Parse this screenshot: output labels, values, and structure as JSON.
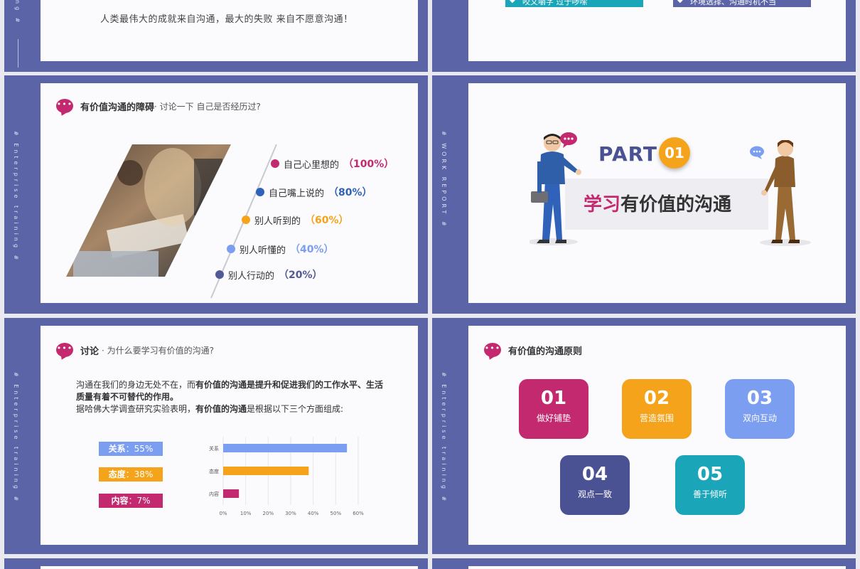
{
  "colors": {
    "frame": "#5a64a6",
    "magenta": "#c3296f",
    "blue": "#2f62b8",
    "orange": "#f5a31a",
    "light_blue": "#7c9ef0",
    "navy": "#525a96",
    "teal": "#1aa5b8",
    "indigo": "#4b5294"
  },
  "slide_top_left": {
    "quote": "人类最伟大的成就来自沟通，最大的失败  来自不愿意沟通！",
    "side_text": "ng #"
  },
  "slide_top_right": {
    "tags": [
      "咬文嚼字  过于啰嗦",
      "环境选择、沟通时机不当"
    ]
  },
  "slide_obstacles": {
    "side_text": "# Enterprise training #",
    "title_bold": "有价值沟通的障碍",
    "title_rest": "· 讨论一下 自己是否经历过?",
    "levels": [
      {
        "label": "自己心里想的",
        "pct": "（100%）",
        "color": "#c3296f"
      },
      {
        "label": "自己嘴上说的",
        "pct": "（80%）",
        "color": "#2f62b8"
      },
      {
        "label": "别人听到的",
        "pct": "（60%）",
        "color": "#f5a31a"
      },
      {
        "label": "别人听懂的",
        "pct": "（40%）",
        "color": "#7c9ef0"
      },
      {
        "label": "别人行动的",
        "pct": "（20%）",
        "color": "#525a96"
      }
    ]
  },
  "slide_part": {
    "side_text": "# WORK  REPORT #",
    "part_label": "PART",
    "part_num": "01",
    "heading_accent": "学习",
    "heading_rest": "有价值的沟通"
  },
  "slide_discuss": {
    "side_text": "# Enterprise training #",
    "title_bold": "讨论",
    "title_rest": "· 为什么要学习有价值的沟通?",
    "para1_a": "沟通在我们的身边无处不在，而",
    "para1_b": "有价值的沟通是提升和促进我们的工作水平、生活质量有着不可替代的作用。",
    "para2_a": "据哈佛大学调查研究实验表明，",
    "para2_b": "有价值的沟通",
    "para2_c": "是根据以下三个方面组成:",
    "stats": [
      {
        "name": "关系",
        "value": "55%",
        "color": "#7c9ef0"
      },
      {
        "name": "态度",
        "value": "38%",
        "color": "#f5a31a"
      },
      {
        "name": "内容",
        "value": "7%",
        "color": "#c3296f"
      }
    ]
  },
  "chart_data": {
    "type": "bar",
    "orientation": "horizontal",
    "categories": [
      "关系",
      "态度",
      "内容"
    ],
    "values": [
      55,
      38,
      7
    ],
    "colors": [
      "#7c9ef0",
      "#f5a31a",
      "#c3296f"
    ],
    "xlim": [
      0,
      60
    ],
    "x_ticks": [
      "0%",
      "10%",
      "20%",
      "30%",
      "40%",
      "50%",
      "60%"
    ],
    "grid": "vertical"
  },
  "slide_principles": {
    "side_text": "# Enterprise training #",
    "title": "有价值的沟通原则",
    "items": [
      {
        "num": "01",
        "label": "做好铺垫",
        "color": "#c3296f"
      },
      {
        "num": "02",
        "label": "营造氛围",
        "color": "#f5a31a"
      },
      {
        "num": "03",
        "label": "双向互动",
        "color": "#7c9ef0"
      },
      {
        "num": "04",
        "label": "观点一致",
        "color": "#4b5294"
      },
      {
        "num": "05",
        "label": "善于倾听",
        "color": "#1aa5b8"
      }
    ]
  }
}
